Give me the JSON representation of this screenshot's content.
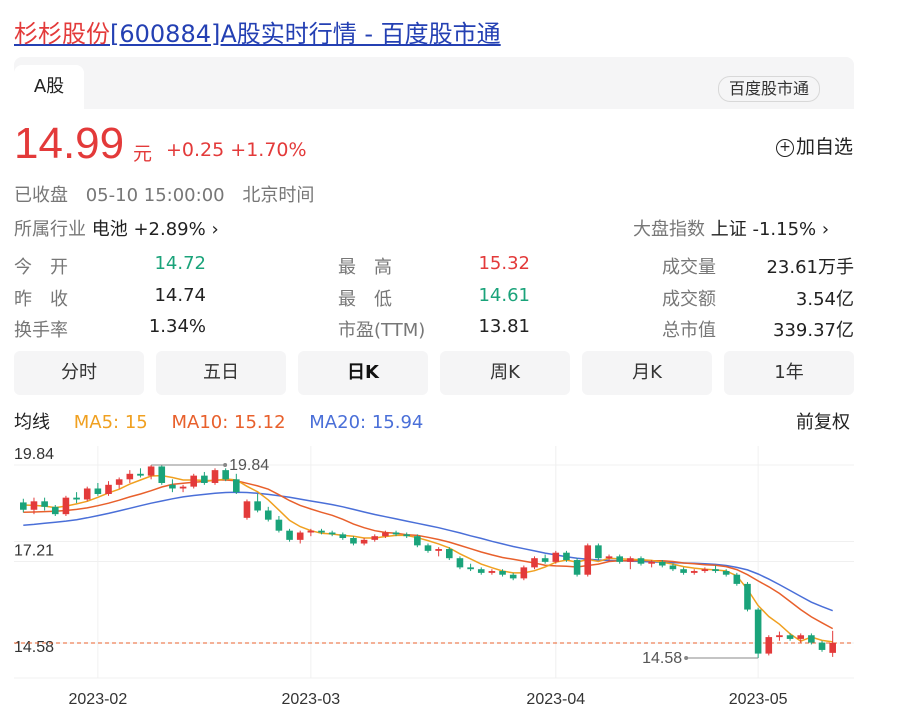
{
  "page": {
    "title_highlight": "杉杉股份",
    "title_rest": "[600884]A股实时行情 - 百度股市通"
  },
  "tabs": {
    "active": "A股",
    "source": "百度股市通"
  },
  "quote": {
    "price": "14.99",
    "unit": "元",
    "change": "+0.25",
    "change_pct": "+1.70%",
    "status": "已收盘",
    "datetime": "05-10 15:00:00",
    "timezone": "北京时间",
    "watch_label": "加自选"
  },
  "industry": {
    "label": "所属行业",
    "name": "电池",
    "change": "+2.89%"
  },
  "market_index": {
    "label": "大盘指数",
    "name": "上证",
    "change": "-1.15%"
  },
  "stats": {
    "open_label": "今　开",
    "open": "14.72",
    "prev_close_label": "昨　收",
    "prev_close": "14.74",
    "turnover_label": "换手率",
    "turnover": "1.34%",
    "high_label": "最　高",
    "high": "15.32",
    "low_label": "最　低",
    "low": "14.61",
    "pe_label": "市盈(TTM)",
    "pe": "13.81",
    "volume_label": "成交量",
    "volume": "23.61万手",
    "amount_label": "成交额",
    "amount": "3.54亿",
    "market_cap_label": "总市值",
    "market_cap": "339.37亿"
  },
  "periods": [
    "分时",
    "五日",
    "日K",
    "周K",
    "月K",
    "1年"
  ],
  "active_period": "日K",
  "ma": {
    "label": "均线",
    "ma5": "MA5: 15",
    "ma10": "MA10: 15.12",
    "ma20": "MA20: 15.94",
    "adjust": "前复权"
  },
  "colors": {
    "up": "#e33a3a",
    "down": "#1aa37a",
    "ma5": "#f0a020",
    "ma10": "#e8602c",
    "ma20": "#4a6fd8",
    "link": "#2440b3"
  },
  "chart_data": {
    "type": "candlestick",
    "y_ticks": [
      "19.84",
      "17.21",
      "14.58"
    ],
    "x_ticks": [
      "2023-02",
      "2023-03",
      "2023-04",
      "2023-05"
    ],
    "x_tick_index": [
      7,
      27,
      50,
      69
    ],
    "ylim": [
      14.58,
      19.84
    ],
    "max_label": "19.84",
    "min_label": "14.58",
    "last_close": 14.99,
    "candles": [
      [
        18.82,
        18.92,
        18.55,
        18.62
      ],
      [
        18.62,
        18.95,
        18.5,
        18.85
      ],
      [
        18.85,
        18.95,
        18.6,
        18.7
      ],
      [
        18.7,
        18.75,
        18.45,
        18.5
      ],
      [
        18.5,
        19.0,
        18.45,
        18.95
      ],
      [
        18.95,
        19.1,
        18.8,
        18.9
      ],
      [
        18.9,
        19.25,
        18.85,
        19.2
      ],
      [
        19.2,
        19.35,
        19.0,
        19.05
      ],
      [
        19.05,
        19.4,
        19.0,
        19.3
      ],
      [
        19.3,
        19.5,
        19.2,
        19.45
      ],
      [
        19.45,
        19.7,
        19.35,
        19.6
      ],
      [
        19.6,
        19.75,
        19.5,
        19.55
      ],
      [
        19.55,
        19.84,
        19.45,
        19.8
      ],
      [
        19.8,
        19.84,
        19.3,
        19.35
      ],
      [
        19.3,
        19.45,
        19.1,
        19.2
      ],
      [
        19.2,
        19.3,
        19.1,
        19.25
      ],
      [
        19.25,
        19.6,
        19.2,
        19.55
      ],
      [
        19.55,
        19.65,
        19.3,
        19.35
      ],
      [
        19.35,
        19.75,
        19.3,
        19.7
      ],
      [
        19.7,
        19.75,
        19.4,
        19.45
      ],
      [
        19.45,
        19.6,
        19.05,
        19.1
      ],
      [
        18.4,
        18.9,
        18.35,
        18.85
      ],
      [
        18.85,
        19.05,
        18.55,
        18.6
      ],
      [
        18.6,
        18.7,
        18.3,
        18.35
      ],
      [
        18.35,
        18.45,
        18.0,
        18.05
      ],
      [
        18.05,
        18.1,
        17.75,
        17.8
      ],
      [
        17.8,
        18.05,
        17.7,
        18.0
      ],
      [
        18.0,
        18.1,
        17.9,
        18.05
      ],
      [
        18.05,
        18.1,
        17.95,
        18.0
      ],
      [
        18.0,
        18.05,
        17.9,
        17.95
      ],
      [
        17.95,
        18.0,
        17.8,
        17.85
      ],
      [
        17.85,
        17.9,
        17.65,
        17.7
      ],
      [
        17.7,
        17.85,
        17.65,
        17.8
      ],
      [
        17.8,
        17.95,
        17.75,
        17.9
      ],
      [
        17.9,
        18.05,
        17.85,
        18.0
      ],
      [
        18.0,
        18.05,
        17.9,
        17.95
      ],
      [
        17.95,
        18.0,
        17.85,
        17.9
      ],
      [
        17.9,
        17.95,
        17.6,
        17.65
      ],
      [
        17.65,
        17.7,
        17.45,
        17.5
      ],
      [
        17.5,
        17.6,
        17.35,
        17.55
      ],
      [
        17.55,
        17.6,
        17.25,
        17.3
      ],
      [
        17.3,
        17.35,
        17.0,
        17.05
      ],
      [
        17.05,
        17.15,
        16.95,
        17.0
      ],
      [
        17.0,
        17.05,
        16.85,
        16.9
      ],
      [
        16.9,
        17.0,
        16.85,
        16.95
      ],
      [
        16.95,
        17.0,
        16.8,
        16.85
      ],
      [
        16.85,
        16.9,
        16.7,
        16.75
      ],
      [
        16.75,
        17.1,
        16.7,
        17.05
      ],
      [
        17.05,
        17.35,
        17.0,
        17.3
      ],
      [
        17.3,
        17.4,
        17.15,
        17.2
      ],
      [
        17.2,
        17.5,
        17.15,
        17.45
      ],
      [
        17.45,
        17.5,
        17.2,
        17.25
      ],
      [
        17.25,
        17.3,
        16.8,
        16.85
      ],
      [
        16.85,
        17.7,
        16.8,
        17.65
      ],
      [
        17.65,
        17.7,
        17.25,
        17.3
      ],
      [
        17.3,
        17.4,
        17.2,
        17.35
      ],
      [
        17.35,
        17.4,
        17.15,
        17.2
      ],
      [
        17.2,
        17.35,
        17.0,
        17.3
      ],
      [
        17.3,
        17.35,
        17.1,
        17.15
      ],
      [
        17.15,
        17.25,
        17.05,
        17.2
      ],
      [
        17.2,
        17.25,
        17.05,
        17.1
      ],
      [
        17.1,
        17.15,
        16.95,
        17.0
      ],
      [
        17.0,
        17.05,
        16.85,
        16.9
      ],
      [
        16.9,
        17.0,
        16.85,
        16.95
      ],
      [
        16.95,
        17.05,
        16.9,
        17.0
      ],
      [
        17.0,
        17.1,
        16.9,
        16.95
      ],
      [
        16.95,
        17.0,
        16.8,
        16.85
      ],
      [
        16.85,
        16.9,
        16.55,
        16.6
      ],
      [
        16.6,
        16.65,
        15.85,
        15.9
      ],
      [
        15.9,
        15.95,
        14.58,
        14.7
      ],
      [
        14.7,
        15.2,
        14.65,
        15.15
      ],
      [
        15.15,
        15.3,
        15.05,
        15.2
      ],
      [
        15.2,
        15.25,
        15.05,
        15.1
      ],
      [
        15.1,
        15.25,
        15.0,
        15.2
      ],
      [
        15.2,
        15.25,
        14.95,
        15.0
      ],
      [
        15.0,
        15.05,
        14.75,
        14.8
      ],
      [
        14.72,
        15.32,
        14.61,
        14.99
      ]
    ],
    "ma5": [
      18.75,
      18.74,
      18.72,
      18.68,
      18.72,
      18.78,
      18.85,
      18.96,
      19.08,
      19.18,
      19.32,
      19.43,
      19.54,
      19.55,
      19.5,
      19.43,
      19.43,
      19.42,
      19.41,
      19.46,
      19.43,
      19.26,
      19.11,
      18.89,
      18.61,
      18.33,
      18.16,
      18.05,
      17.98,
      17.96,
      17.92,
      17.9,
      17.85,
      17.85,
      17.89,
      17.92,
      17.92,
      17.86,
      17.78,
      17.69,
      17.58,
      17.42,
      17.28,
      17.14,
      17.04,
      16.95,
      16.9,
      16.9,
      16.96,
      17.06,
      17.19,
      17.25,
      17.19,
      17.27,
      17.21,
      17.3,
      17.28,
      17.27,
      17.26,
      17.24,
      17.19,
      17.14,
      17.07,
      17.03,
      17.0,
      16.98,
      16.95,
      16.82,
      16.45,
      16.01,
      15.71,
      15.5,
      15.24,
      15.04,
      15.15,
      15.06,
      15.02
    ],
    "ma10": [
      18.55,
      18.56,
      18.57,
      18.58,
      18.6,
      18.63,
      18.67,
      18.73,
      18.8,
      18.88,
      18.97,
      19.05,
      19.14,
      19.24,
      19.31,
      19.34,
      19.37,
      19.39,
      19.43,
      19.43,
      19.41,
      19.34,
      19.27,
      19.18,
      19.03,
      18.87,
      18.74,
      18.64,
      18.55,
      18.47,
      18.36,
      18.23,
      18.13,
      18.05,
      18.0,
      17.98,
      17.94,
      17.92,
      17.87,
      17.81,
      17.74,
      17.65,
      17.56,
      17.47,
      17.39,
      17.32,
      17.27,
      17.22,
      17.17,
      17.11,
      17.09,
      17.08,
      17.06,
      17.1,
      17.14,
      17.21,
      17.23,
      17.23,
      17.24,
      17.23,
      17.23,
      17.21,
      17.17,
      17.15,
      17.12,
      17.11,
      17.07,
      16.99,
      16.85,
      16.68,
      16.52,
      16.34,
      16.12,
      15.9,
      15.7,
      15.54,
      15.38
    ],
    "ma20": [
      18.2,
      18.22,
      18.25,
      18.28,
      18.31,
      18.35,
      18.4,
      18.46,
      18.52,
      18.59,
      18.66,
      18.73,
      18.8,
      18.86,
      18.92,
      18.97,
      19.01,
      19.04,
      19.07,
      19.09,
      19.1,
      19.09,
      19.07,
      19.04,
      19.0,
      18.96,
      18.91,
      18.86,
      18.81,
      18.76,
      18.7,
      18.63,
      18.56,
      18.49,
      18.43,
      18.37,
      18.31,
      18.25,
      18.19,
      18.13,
      18.06,
      17.99,
      17.91,
      17.84,
      17.76,
      17.69,
      17.62,
      17.56,
      17.5,
      17.44,
      17.39,
      17.34,
      17.3,
      17.27,
      17.25,
      17.24,
      17.23,
      17.22,
      17.21,
      17.2,
      17.19,
      17.18,
      17.17,
      17.16,
      17.15,
      17.13,
      17.1,
      17.05,
      16.98,
      16.87,
      16.73,
      16.58,
      16.42,
      16.26,
      16.1,
      15.98,
      15.87
    ]
  }
}
